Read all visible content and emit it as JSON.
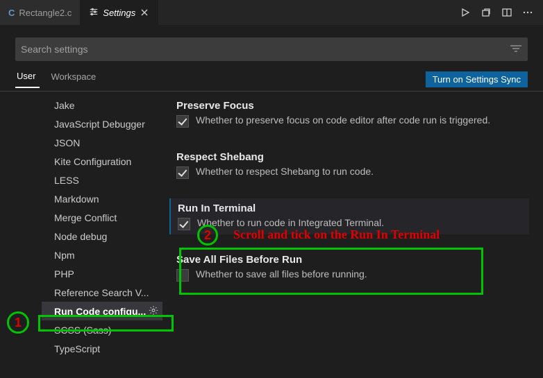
{
  "tabs": {
    "items": [
      {
        "label": "Rectangle2.c",
        "icon": "c-file-icon",
        "active": false
      },
      {
        "label": "Settings",
        "icon": "settings-icon",
        "active": true
      }
    ]
  },
  "search": {
    "placeholder": "Search settings"
  },
  "scopes": {
    "user": "User",
    "workspace": "Workspace",
    "sync_button": "Turn on Settings Sync"
  },
  "sidenav": {
    "items": [
      "Jake",
      "JavaScript Debugger",
      "JSON",
      "Kite Configuration",
      "LESS",
      "Markdown",
      "Merge Conflict",
      "Node debug",
      "Npm",
      "PHP",
      "Reference Search V...",
      "Run Code configu...",
      "SCSS (Sass)",
      "TypeScript"
    ],
    "selected_index": 11
  },
  "settings": {
    "preserve_focus": {
      "title": "Preserve Focus",
      "desc": "Whether to preserve focus on code editor after code run is triggered.",
      "checked": true
    },
    "respect_shebang": {
      "title": "Respect Shebang",
      "desc": "Whether to respect Shebang to run code.",
      "checked": true
    },
    "run_in_terminal": {
      "title": "Run In Terminal",
      "desc": "Whether to run code in Integrated Terminal.",
      "checked": true
    },
    "save_all": {
      "title": "Save All Files Before Run",
      "desc": "Whether to save all files before running.",
      "checked": false
    }
  },
  "annotations": {
    "n1": "1",
    "n2": "2",
    "text": "Scroll and tick on the Run In Terminal"
  }
}
